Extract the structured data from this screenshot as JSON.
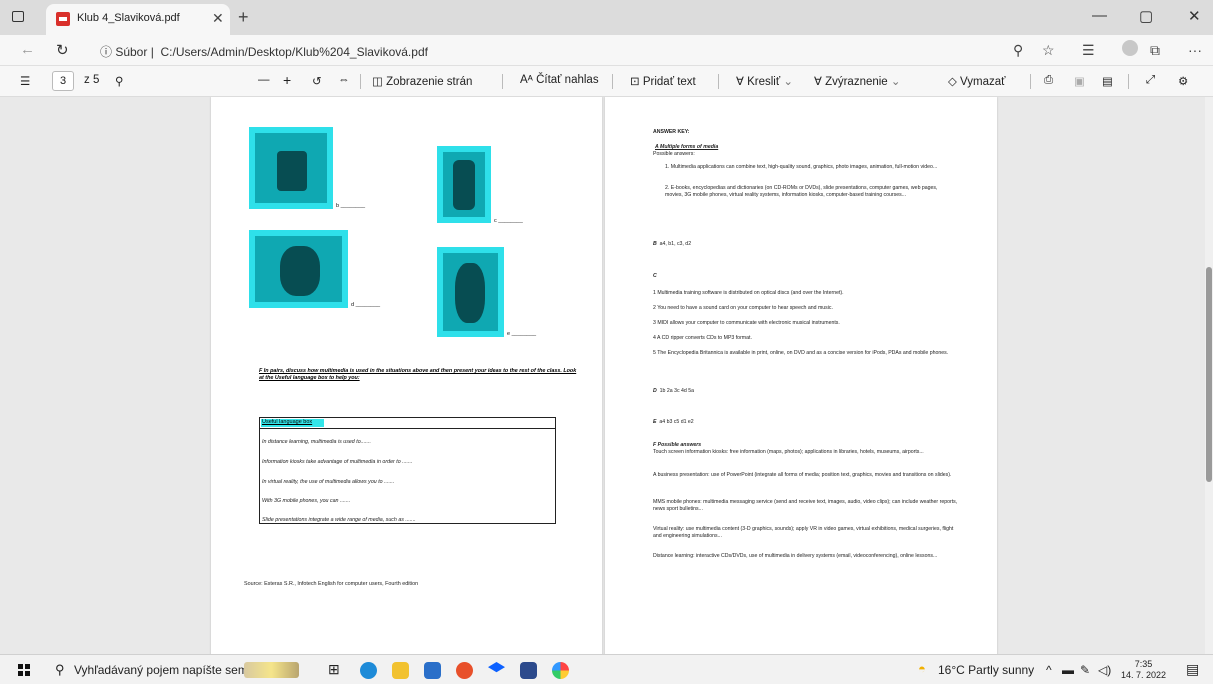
{
  "browser": {
    "tab_title": "Klub 4_Slaviková.pdf",
    "tab_close": "✕",
    "new_tab": "+",
    "url_prefix": "ⓘ Súbor",
    "url": "C:/Users/Admin/Desktop/Klub%204_Slaviková.pdf",
    "win_min": "—",
    "win_max": "▢",
    "win_close": "✕",
    "more": "···"
  },
  "pdf_toolbar": {
    "page_current": "3",
    "page_total": "z 5",
    "zoom_out": "—",
    "zoom_in": "+",
    "page_view": "Zobrazenie strán",
    "read_aloud": "Čítať nahlas",
    "add_text": "Pridať text",
    "draw": "Kresliť",
    "highlight": "Zvýraznenie",
    "erase": "Vymazať"
  },
  "left_page": {
    "captions": [
      "b ________",
      "c ________",
      "d ________",
      "e ________"
    ],
    "task_f": "F  In pairs, discuss how multimedia is used in the situations above and then present your ideas to the rest of the class. Look at the Useful language box to help you:",
    "useful_box_title": "Useful language box",
    "useful_lines": [
      "In distance learning, multimedia is used to.......",
      "Information kiosks take advantage of multimedia in order to .......",
      "In virtual reality, the use of multimedia allows you to .......",
      "With 3G mobile phones, you can .......",
      "Slide presentations integrate a wide range of media, such as ......."
    ],
    "source": "Source: Esteras S.R., Infotech English for computer users, Fourth edition"
  },
  "right_page": {
    "answer_key": "ANSWER KEY:",
    "section_a": "A  Multiple forms of media",
    "possible_answers": "Possible answers:",
    "a_items": [
      "1.  Multimedia applications can combine text, high-quality sound, graphics, photo images, animation, full-motion video...",
      "2.  E-books, encyclopedias and dictionaries (on CD-ROMs or DVDs), slide presentations, computer games, web pages, movies, 3G mobile phones, virtual reality systems, information kiosks, computer-based training courses..."
    ],
    "b_label": "B",
    "b_answers": "a4,  b1,  c3,  d2",
    "c_label": "C",
    "c_items": [
      "1 Multimedia training software is distributed on optical discs (and over the Internet).",
      "2 You need to have a sound card on your computer to hear speech and music.",
      "3 MIDI allows your computer to communicate with electronic musical instruments.",
      "4 A CD ripper converts CDs to MP3 format.",
      "5 The Encyclopedia Britannica is available in print, online, on DVD and as a concise version for iPods, PDAs and mobile phones."
    ],
    "d_label": "D",
    "d_answers": "1b   2a   3c   4d   5a",
    "e_label": "E",
    "e_answers": "a4   b3   c5   d1   e2",
    "f_label": "F  Possible answers",
    "f_items": [
      "Touch screen information kiosks: free information (maps, photos); applications in libraries, hotels, museums, airports...",
      "A business presentation: use of PowerPoint (integrate all forms of media; position text, graphics, movies and transitions on slides).",
      "MMS mobile phones: multimedia messaging service (send and receive text, images, audio, video clips); can include weather reports, news sport bulletins...",
      "Virtual reality: use multimedia content (3-D graphics, sounds); apply VR in video games, virtual exhibitions, medical surgeries, flight and engineering simulations...",
      "Distance learning: interactive CDs/DVDs, use of multimedia in delivery systems (email, videoconferencing), online lessons..."
    ]
  },
  "taskbar": {
    "search_text": "Vyhľadávaný pojem napíšte sem",
    "weather": "16°C  Partly sunny",
    "time": "7:35",
    "date": "14. 7. 2022"
  }
}
